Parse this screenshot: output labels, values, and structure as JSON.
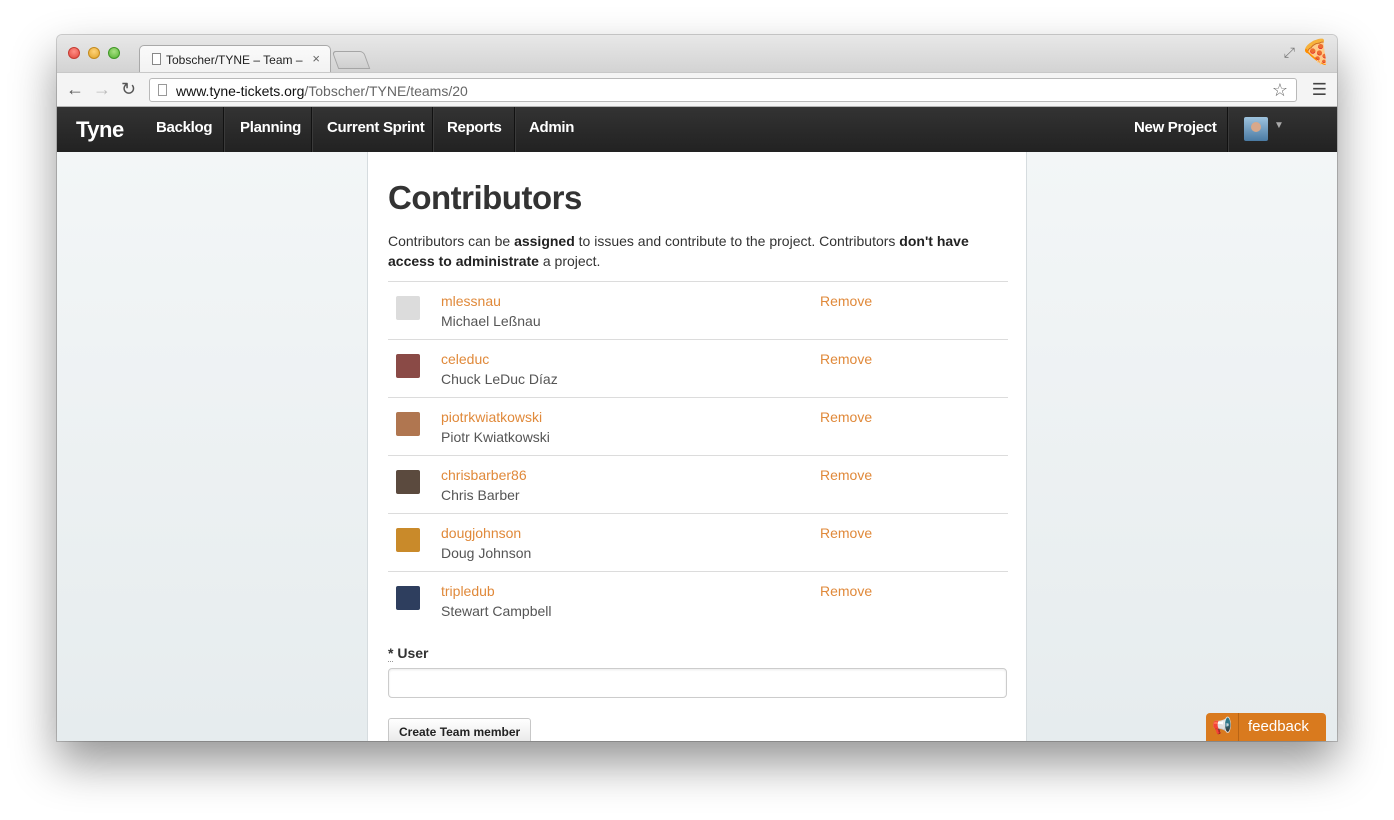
{
  "browser": {
    "tab_title": "Tobscher/TYNE – Team – ",
    "tab_close": "×",
    "url_host": "www.tyne-tickets.org",
    "url_path": "/Tobscher/TYNE/teams/20"
  },
  "icons": {
    "back": "arrow-left-icon",
    "forward": "arrow-right-icon",
    "reload": "reload-icon",
    "star": "star-icon",
    "menu": "hamburger-menu-icon",
    "pizza": "pizza-extension-icon",
    "megaphone": "megaphone-icon"
  },
  "nav": {
    "brand": "Tyne",
    "items": [
      "Backlog",
      "Planning",
      "Current Sprint",
      "Reports",
      "Admin"
    ],
    "new_project": "New Project"
  },
  "page": {
    "title": "Contributors",
    "intro_1": "Contributors can be ",
    "intro_bold_1": "assigned",
    "intro_2": " to issues and contribute to the project. Contributors ",
    "intro_bold_2": "don't have access to administrate",
    "intro_3": " a project."
  },
  "members": [
    {
      "login": "mlessnau",
      "name": "Michael Leßnau",
      "action": "Remove",
      "avatar_color": "#dcdcdc"
    },
    {
      "login": "celeduc",
      "name": "Chuck LeDuc Díaz",
      "action": "Remove",
      "avatar_color": "#8a4a46"
    },
    {
      "login": "piotrkwiatkowski",
      "name": "Piotr Kwiatkowski",
      "action": "Remove",
      "avatar_color": "#b07650"
    },
    {
      "login": "chrisbarber86",
      "name": "Chris Barber",
      "action": "Remove",
      "avatar_color": "#5b4a3e"
    },
    {
      "login": "dougjohnson",
      "name": "Doug Johnson",
      "action": "Remove",
      "avatar_color": "#c98a2a"
    },
    {
      "login": "tripledub",
      "name": "Stewart Campbell",
      "action": "Remove",
      "avatar_color": "#2e3e5e"
    }
  ],
  "form": {
    "required_mark": "*",
    "user_label": "User",
    "user_value": "",
    "submit_label": "Create Team member"
  },
  "feedback": {
    "label": "feedback"
  },
  "colors": {
    "link": "#e0893a",
    "navbar": "#2b2b2b",
    "feedback": "#d97a1e"
  }
}
